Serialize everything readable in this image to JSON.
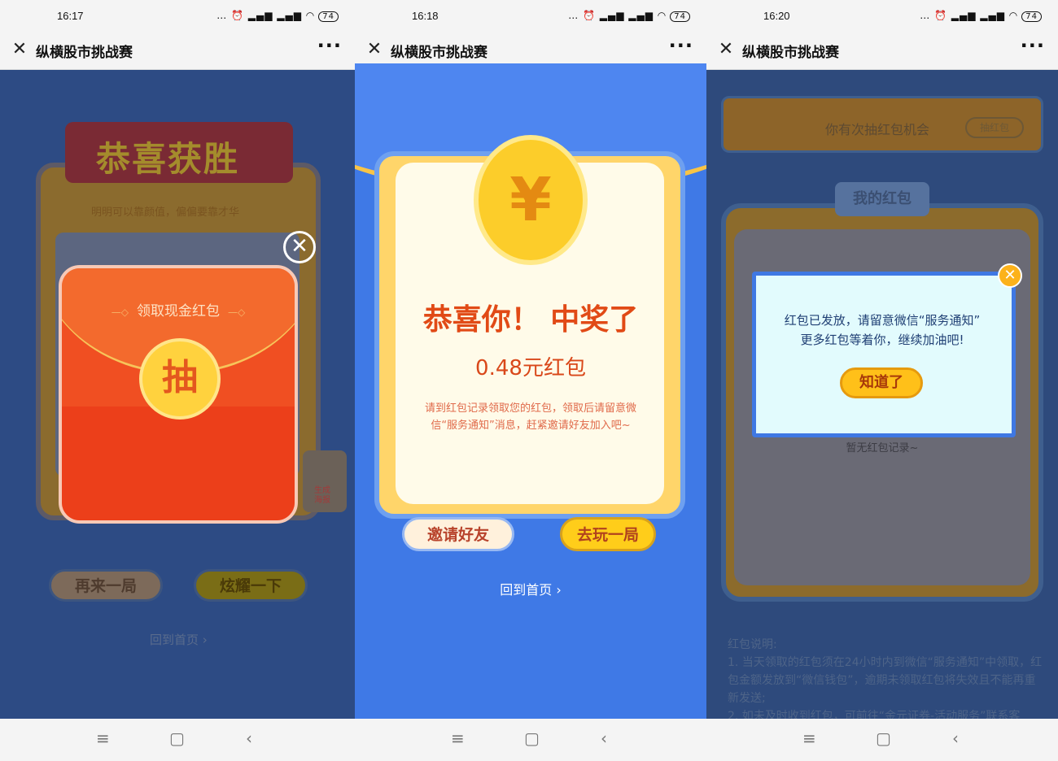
{
  "app_title": "纵横股市挑战赛",
  "screens": [
    {
      "time": "16:17",
      "battery": "74",
      "win_banner": "恭喜获胜",
      "win_subtitle": "明明可以靠颜值，偏偏要靠才华",
      "envelope_label": "领取现金红包",
      "envelope_button": "抽",
      "poster_label": "生成\n海报",
      "buttons": [
        "再来一局",
        "炫耀一下"
      ],
      "home_link": "回到首页 ›"
    },
    {
      "time": "16:18",
      "battery": "74",
      "coin_symbol": "¥",
      "headline": "恭喜你！ 中奖了",
      "amount": "0.48元红包",
      "description": "请到红包记录领取您的红包，领取后请留意微信“服务通知”消息，赶紧邀请好友加入吧~",
      "buttons": [
        "邀请好友",
        "去玩一局"
      ],
      "home_link": "回到首页 ›"
    },
    {
      "time": "16:20",
      "battery": "74",
      "banner_text": "你有次抽红包机会",
      "banner_button": "抽红包",
      "tab_label": "我的红包",
      "empty_text": "暂无红包记录~",
      "modal_text": "红包已发放，请留意微信“服务通知”\n更多红包等着你，继续加油吧!",
      "modal_button": "知道了",
      "notes": "红包说明:\n1. 当天领取的红包须在24小时内到微信“服务通知”中领取，红包金额发放到“微信钱包”，逾期未领取红包将失效且不能再重新发送;\n2. 如未及时收到红包，可前往“金元证券-活动服务”联系客"
    }
  ],
  "status_icons": "… ⏰ ▂▄▆ ▂▄▆ ◠",
  "nav_icons": [
    "≡",
    "▢",
    "‹"
  ],
  "colors": {
    "panel1_bg": "#2d4b84",
    "panel2_bg": "#3f79e6",
    "panel3_bg": "#2e4a7c",
    "accent_red": "#e14a16",
    "accent_gold": "#ffcd1a"
  }
}
